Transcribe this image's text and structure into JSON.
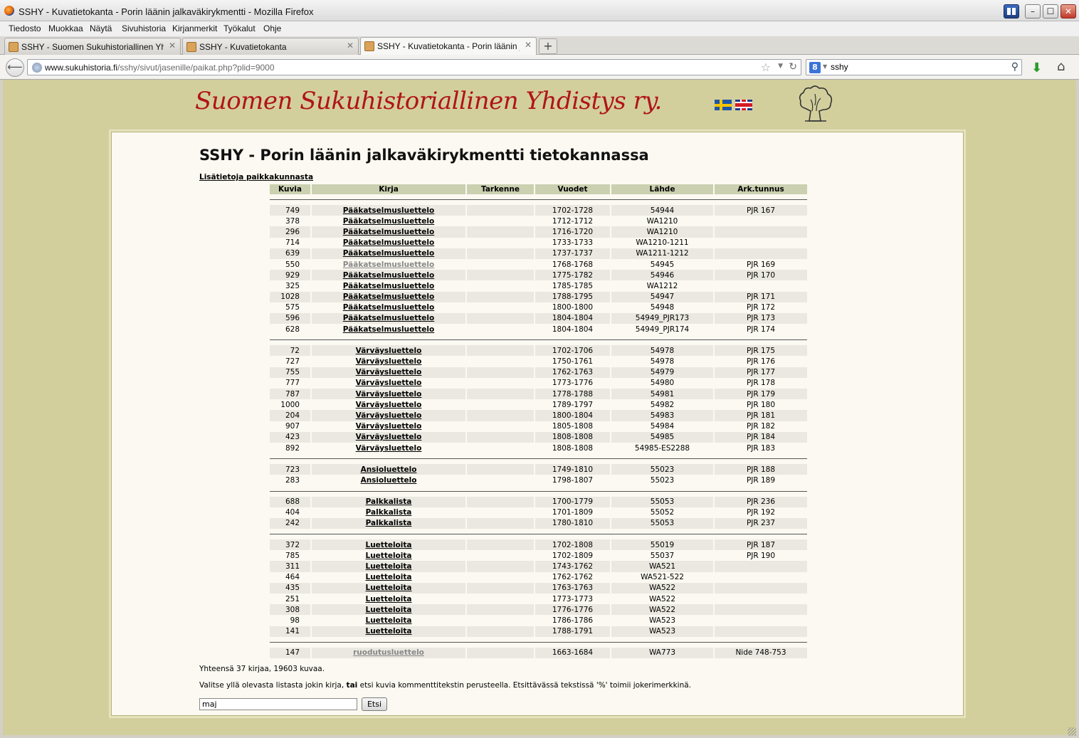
{
  "window": {
    "title": "SSHY - Kuvatietokanta - Porin läänin jalkaväkirykmentti - Mozilla Firefox"
  },
  "menu": [
    "Tiedosto",
    "Muokkaa",
    "Näytä",
    "Sivuhistoria",
    "Kirjanmerkit",
    "Työkalut",
    "Ohje"
  ],
  "tabs": [
    {
      "label": "SSHY - Suomen Sukuhistoriallinen Yhdisty...",
      "active": false
    },
    {
      "label": "SSHY - Kuvatietokanta",
      "active": false
    },
    {
      "label": "SSHY - Kuvatietokanta - Porin läänin jalka...",
      "active": true
    }
  ],
  "nav": {
    "url_domain": "www.sukuhistoria.fi",
    "url_path": "/sshy/sivut/jasenille/paikat.php?plid=9000",
    "search_value": "sshy"
  },
  "site": {
    "name": "Suomen Sukuhistoriallinen Yhdistys ry."
  },
  "page": {
    "heading": "SSHY - Porin läänin jalkaväkirykmentti tietokannassa",
    "info_link": "Lisätietoja paikkakunnasta",
    "columns": [
      "Kuvia",
      "Kirja",
      "Tarkenne",
      "Vuodet",
      "Lähde",
      "Ark.tunnus"
    ],
    "groups": [
      [
        {
          "count": "749",
          "book": "Pääkatselmusluettelo",
          "years": "1702-1728",
          "source": "54944",
          "ark": "PJR 167"
        },
        {
          "count": "378",
          "book": "Pääkatselmusluettelo",
          "years": "1712-1712",
          "source": "WA1210",
          "ark": ""
        },
        {
          "count": "296",
          "book": "Pääkatselmusluettelo",
          "years": "1716-1720",
          "source": "WA1210",
          "ark": ""
        },
        {
          "count": "714",
          "book": "Pääkatselmusluettelo",
          "years": "1733-1733",
          "source": "WA1210-1211",
          "ark": ""
        },
        {
          "count": "639",
          "book": "Pääkatselmusluettelo",
          "years": "1737-1737",
          "source": "WA1211-1212",
          "ark": ""
        },
        {
          "count": "550",
          "book": "Pääkatselmusluettelo",
          "years": "1768-1768",
          "source": "54945",
          "ark": "PJR 169",
          "visited": true
        },
        {
          "count": "929",
          "book": "Pääkatselmusluettelo",
          "years": "1775-1782",
          "source": "54946",
          "ark": "PJR 170"
        },
        {
          "count": "325",
          "book": "Pääkatselmusluettelo",
          "years": "1785-1785",
          "source": "WA1212",
          "ark": ""
        },
        {
          "count": "1028",
          "book": "Pääkatselmusluettelo",
          "years": "1788-1795",
          "source": "54947",
          "ark": "PJR 171"
        },
        {
          "count": "575",
          "book": "Pääkatselmusluettelo",
          "years": "1800-1800",
          "source": "54948",
          "ark": "PJR 172"
        },
        {
          "count": "596",
          "book": "Pääkatselmusluettelo",
          "years": "1804-1804",
          "source": "54949_PJR173",
          "ark": "PJR 173"
        },
        {
          "count": "628",
          "book": "Pääkatselmusluettelo",
          "years": "1804-1804",
          "source": "54949_PJR174",
          "ark": "PJR 174"
        }
      ],
      [
        {
          "count": "72",
          "book": "Värväysluettelo",
          "years": "1702-1706",
          "source": "54978",
          "ark": "PJR 175"
        },
        {
          "count": "727",
          "book": "Värväysluettelo",
          "years": "1750-1761",
          "source": "54978",
          "ark": "PJR 176"
        },
        {
          "count": "755",
          "book": "Värväysluettelo",
          "years": "1762-1763",
          "source": "54979",
          "ark": "PJR 177"
        },
        {
          "count": "777",
          "book": "Värväysluettelo",
          "years": "1773-1776",
          "source": "54980",
          "ark": "PJR 178"
        },
        {
          "count": "787",
          "book": "Värväysluettelo",
          "years": "1778-1788",
          "source": "54981",
          "ark": "PJR 179"
        },
        {
          "count": "1000",
          "book": "Värväysluettelo",
          "years": "1789-1797",
          "source": "54982",
          "ark": "PJR 180"
        },
        {
          "count": "204",
          "book": "Värväysluettelo",
          "years": "1800-1804",
          "source": "54983",
          "ark": "PJR 181"
        },
        {
          "count": "907",
          "book": "Värväysluettelo",
          "years": "1805-1808",
          "source": "54984",
          "ark": "PJR 182"
        },
        {
          "count": "423",
          "book": "Värväysluettelo",
          "years": "1808-1808",
          "source": "54985",
          "ark": "PJR 184"
        },
        {
          "count": "892",
          "book": "Värväysluettelo",
          "years": "1808-1808",
          "source": "54985-ES2288",
          "ark": "PJR 183"
        }
      ],
      [
        {
          "count": "723",
          "book": "Ansioluettelo",
          "years": "1749-1810",
          "source": "55023",
          "ark": "PJR 188"
        },
        {
          "count": "283",
          "book": "Ansioluettelo",
          "years": "1798-1807",
          "source": "55023",
          "ark": "PJR 189"
        }
      ],
      [
        {
          "count": "688",
          "book": "Palkkalista",
          "years": "1700-1779",
          "source": "55053",
          "ark": "PJR 236"
        },
        {
          "count": "404",
          "book": "Palkkalista",
          "years": "1701-1809",
          "source": "55052",
          "ark": "PJR 192"
        },
        {
          "count": "242",
          "book": "Palkkalista",
          "years": "1780-1810",
          "source": "55053",
          "ark": "PJR 237"
        }
      ],
      [
        {
          "count": "372",
          "book": "Luetteloita",
          "years": "1702-1808",
          "source": "55019",
          "ark": "PJR 187"
        },
        {
          "count": "785",
          "book": "Luetteloita",
          "years": "1702-1809",
          "source": "55037",
          "ark": "PJR 190"
        },
        {
          "count": "311",
          "book": "Luetteloita",
          "years": "1743-1762",
          "source": "WA521",
          "ark": ""
        },
        {
          "count": "464",
          "book": "Luetteloita",
          "years": "1762-1762",
          "source": "WA521-522",
          "ark": ""
        },
        {
          "count": "435",
          "book": "Luetteloita",
          "years": "1763-1763",
          "source": "WA522",
          "ark": ""
        },
        {
          "count": "251",
          "book": "Luetteloita",
          "years": "1773-1773",
          "source": "WA522",
          "ark": ""
        },
        {
          "count": "308",
          "book": "Luetteloita",
          "years": "1776-1776",
          "source": "WA522",
          "ark": ""
        },
        {
          "count": "98",
          "book": "Luetteloita",
          "years": "1786-1786",
          "source": "WA523",
          "ark": ""
        },
        {
          "count": "141",
          "book": "Luetteloita",
          "years": "1788-1791",
          "source": "WA523",
          "ark": ""
        }
      ],
      [
        {
          "count": "147",
          "book": "ruodutusluettelo",
          "years": "1663-1684",
          "source": "WA773",
          "ark": "Nide 748-753",
          "visited": true
        }
      ]
    ],
    "summary": "Yhteensä 37 kirjaa, 19603 kuvaa.",
    "instr_before": "Valitse yllä olevasta listasta jokin kirja, ",
    "instr_bold": "tai",
    "instr_after": " etsi kuvia kommenttitekstin perusteella. Etsittävässä tekstissä '%' toimii jokerimerkkinä.",
    "search_value": "maj",
    "search_button": "Etsi"
  }
}
